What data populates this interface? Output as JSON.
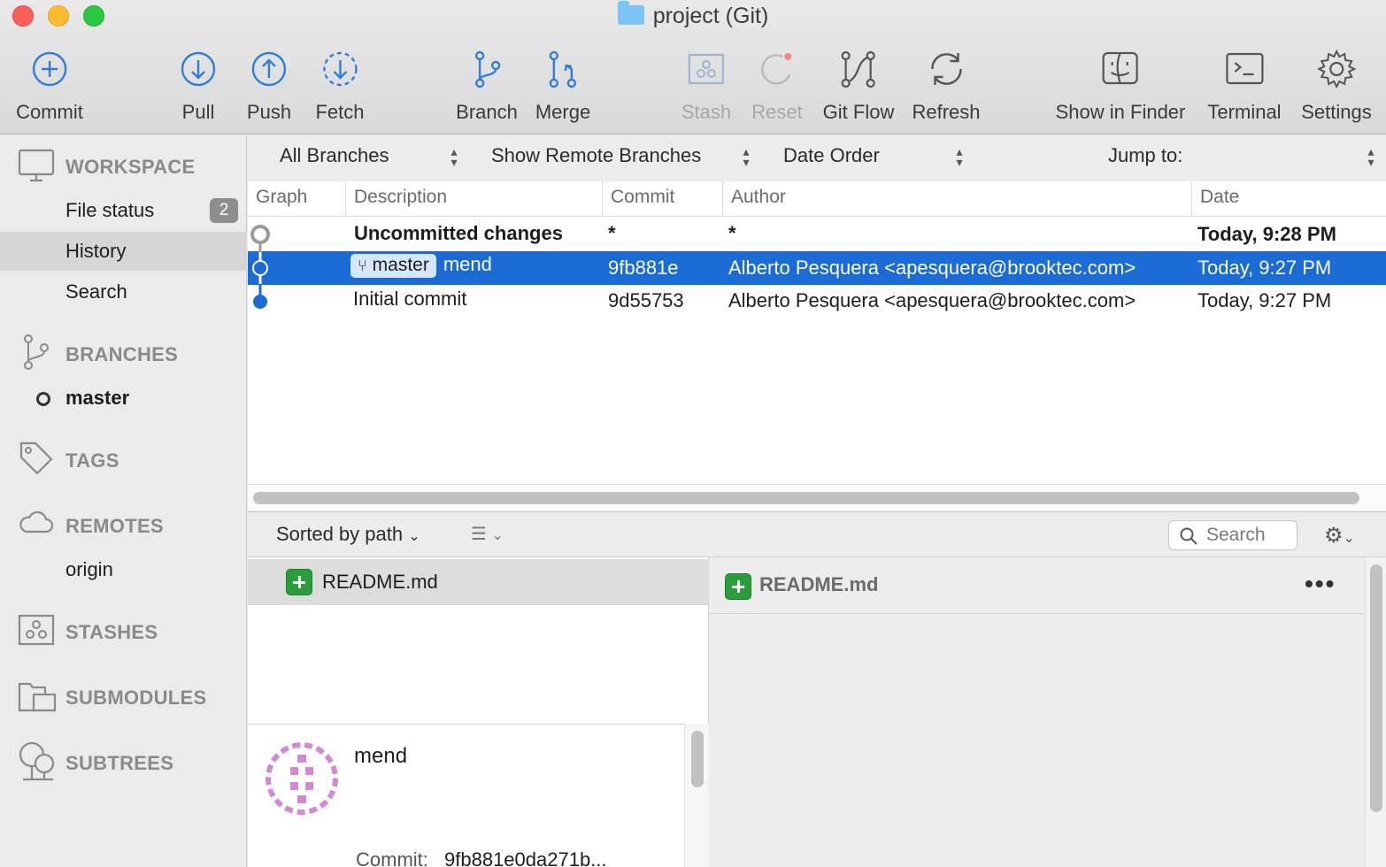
{
  "window": {
    "title": "project (Git)"
  },
  "toolbar": {
    "commit": "Commit",
    "pull": "Pull",
    "push": "Push",
    "fetch": "Fetch",
    "branch": "Branch",
    "merge": "Merge",
    "stash": "Stash",
    "reset": "Reset",
    "gitflow": "Git Flow",
    "refresh": "Refresh",
    "finder": "Show in Finder",
    "terminal": "Terminal",
    "settings": "Settings"
  },
  "sidebar": {
    "workspace": "WORKSPACE",
    "file_status": "File status",
    "file_status_count": "2",
    "history": "History",
    "search": "Search",
    "branches": "BRANCHES",
    "branch_master": "master",
    "tags": "TAGS",
    "remotes": "REMOTES",
    "remote_origin": "origin",
    "stashes": "STASHES",
    "submodules": "SUBMODULES",
    "subtrees": "SUBTREES"
  },
  "filters": {
    "branches": "All Branches",
    "remote": "Show Remote Branches",
    "order": "Date Order",
    "jump": "Jump to:"
  },
  "columns": {
    "graph": "Graph",
    "description": "Description",
    "commit": "Commit",
    "author": "Author",
    "date": "Date"
  },
  "rows": [
    {
      "description": "Uncommitted changes",
      "commit": "*",
      "author": "*",
      "date": "Today, 9:28 PM"
    },
    {
      "tag": "master",
      "description": "mend",
      "commit": "9fb881e",
      "author": "Alberto Pesquera <apesquera@brooktec.com>",
      "date": "Today, 9:27 PM"
    },
    {
      "description": "Initial commit",
      "commit": "9d55753",
      "author": "Alberto Pesquera <apesquera@brooktec.com>",
      "date": "Today, 9:27 PM"
    }
  ],
  "lower": {
    "sort": "Sorted by path",
    "search_placeholder": "Search",
    "file": "README.md",
    "diff_file": "README.md",
    "message": "mend",
    "commit_label": "Commit:",
    "commit_hash": "9fb881e0da271b..."
  },
  "colors": {
    "selection": "#1a6bd5",
    "tool_blue": "#2f7fd8",
    "added": "#2a9e3a",
    "avatar": "#d487d2"
  }
}
